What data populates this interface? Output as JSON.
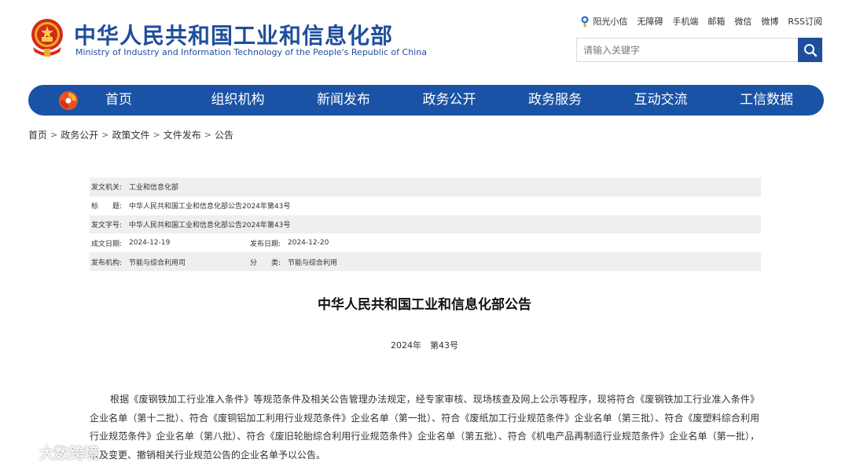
{
  "header": {
    "title_cn": "中华人民共和国工业和信息化部",
    "title_en": "Ministry of Industry and Information Technology of the People's Republic of China",
    "emblem_icon": "national-emblem-icon",
    "toplinks": [
      "阳光小信",
      "无障碍",
      "手机端",
      "邮箱",
      "微信",
      "微博",
      "RSS订阅"
    ],
    "search": {
      "placeholder": "请输入关键字",
      "button_icon": "search-icon"
    }
  },
  "nav": {
    "logo_icon": "miit-logo-icon",
    "items": [
      "首页",
      "组织机构",
      "新闻发布",
      "政务公开",
      "政务服务",
      "互动交流",
      "工信数据"
    ],
    "color": "#1a53a6"
  },
  "breadcrumb": [
    "首页",
    "政务公开",
    "政策文件",
    "文件发布",
    "公告"
  ],
  "info": {
    "issuer_label": "发文机关:",
    "issuer": "工业和信息化部",
    "title_label": "标　　题:",
    "title": "中华人民共和国工业和信息化部公告2024年第43号",
    "docno_label": "发文字号:",
    "docno": "中华人民共和国工业和信息化部公告2024年第43号",
    "created_label": "成文日期:",
    "created": "2024-12-19",
    "published_label": "发布日期:",
    "published": "2024-12-20",
    "org_label": "发布机构:",
    "org": "节能与综合利用司",
    "category_label": "分　　类:",
    "category": "节能与综合利用"
  },
  "document": {
    "title": "中华人民共和国工业和信息化部公告",
    "number": "2024年　第43号",
    "body": "根据《废钢铁加工行业准入条件》等规范条件及相关公告管理办法规定，经专家审核、现场核查及网上公示等程序，现将符合《废钢铁加工行业准入条件》企业名单（第十二批）、符合《废铜铝加工利用行业规范条件》企业名单（第一批）、符合《废纸加工行业规范条件》企业名单（第三批）、符合《废塑料综合利用行业规范条件》企业名单（第八批）、符合《废旧轮胎综合利用行业规范条件》企业名单（第五批）、符合《机电产品再制造行业规范条件》企业名单（第一批），以及变更、撤销相关行业规范公告的企业名单予以公告。"
  },
  "watermark": {
    "text": "大数跨境",
    "icon": "watermark-logo-icon"
  }
}
